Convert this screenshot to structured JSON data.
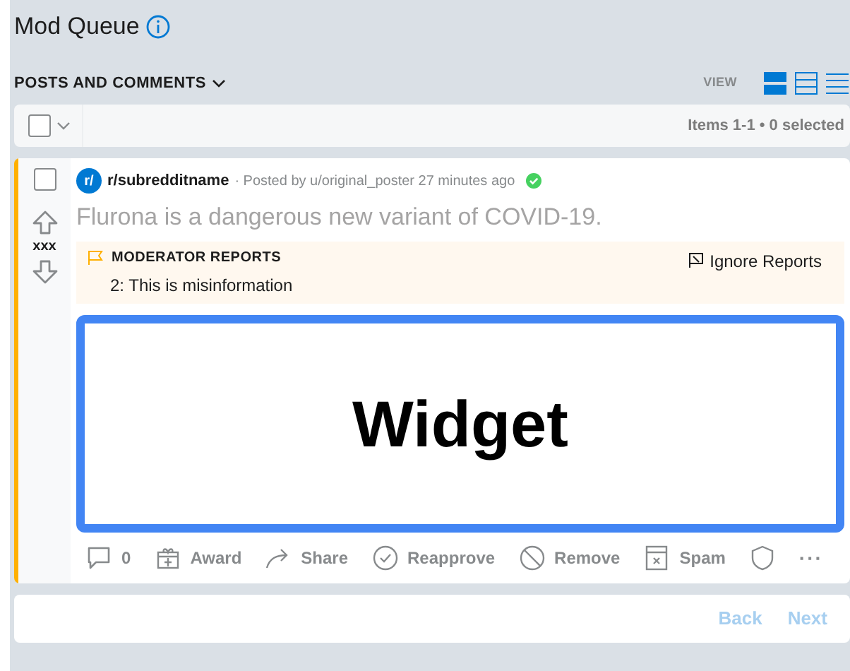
{
  "header": {
    "title": "Mod Queue"
  },
  "filter": {
    "label": "POSTS AND COMMENTS"
  },
  "view": {
    "label": "VIEW",
    "modes": [
      {
        "kind": "card",
        "selected": true
      },
      {
        "kind": "classic",
        "selected": false
      },
      {
        "kind": "compact",
        "selected": false
      }
    ]
  },
  "toolbar": {
    "select_all_checked": false,
    "count": "Items 1-1 • 0 selected"
  },
  "posts": [
    {
      "checked": false,
      "votes": "xxx",
      "subreddit_icon": "r/",
      "subreddit": "r/subredditname",
      "meta": "· Posted by u/original_poster 27 minutes ago",
      "approved": true,
      "title": "Flurona is a dangerous new variant of COVID-19.",
      "reports": {
        "heading": "MODERATOR REPORTS",
        "items": [
          "2: This is misinformation"
        ],
        "ignore_label": "Ignore Reports"
      },
      "widget": "Widget",
      "actions": [
        {
          "kind": "comments",
          "label": "0"
        },
        {
          "kind": "award",
          "label": "Award"
        },
        {
          "kind": "share",
          "label": "Share"
        },
        {
          "kind": "reapprove",
          "label": "Reapprove"
        },
        {
          "kind": "remove",
          "label": "Remove"
        },
        {
          "kind": "spam",
          "label": "Spam"
        },
        {
          "kind": "shield"
        },
        {
          "kind": "more",
          "label": "···"
        }
      ]
    }
  ],
  "pagination": [
    {
      "label": "Back",
      "disabled": true
    },
    {
      "label": "Next",
      "disabled": true
    }
  ]
}
